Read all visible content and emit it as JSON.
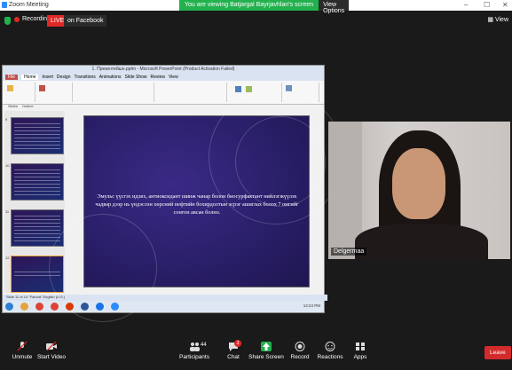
{
  "window": {
    "title": "Zoom Meeting",
    "share_message": "You are viewing Batjargal Bayrjavhlan's screen",
    "view_options": "View Options",
    "controls": [
      "–",
      "☐",
      "✕"
    ]
  },
  "toprow": {
    "recording": "Recording",
    "live": "LIVE",
    "on_facebook": "on Facebook",
    "view": "View"
  },
  "ppt": {
    "title": "1. Презентейшн.pptm - Microsoft PowerPoint (Product Activation Failed)",
    "tabs": [
      "File",
      "Home",
      "Insert",
      "Design",
      "Transitions",
      "Animations",
      "Slide Show",
      "Review",
      "View"
    ],
    "panel_tabs": [
      "Slides",
      "Outline"
    ],
    "slide_text": "Эмульс үүсгэх идэвх, антиоксидант шинж чанар болон биосурфактант нийлэгжүүлэх чадвар дээр нь үндэслэн хөрсний нефтийн бохирдолтын эсрэг ашиглах болох 7 омгийг сонгон авсан болно.",
    "status": "Slide 11 of 14    \"Fabula\"    English (U.S.)",
    "thumb_numbers": [
      "9",
      "10",
      "11",
      "12"
    ],
    "clock": "12:24 PM"
  },
  "camera": {
    "name": "Delgermaa"
  },
  "bottom": {
    "unmute": "Unmute",
    "start_video": "Start Video",
    "participants": "Participants",
    "participants_count": "44",
    "chat": "Chat",
    "chat_badge": "3",
    "share_screen": "Share Screen",
    "record": "Record",
    "reactions": "Reactions",
    "apps": "Apps",
    "leave": "Leave"
  }
}
